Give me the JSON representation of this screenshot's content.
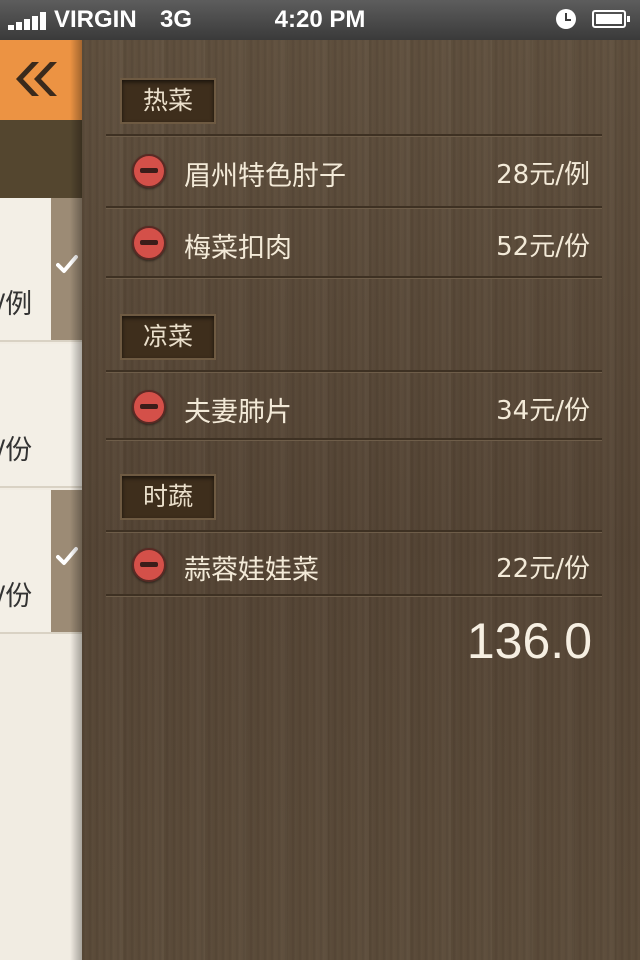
{
  "statusbar": {
    "carrier": "VIRGIN",
    "network": "3G",
    "time": "4:20 PM"
  },
  "sidebar": {
    "items": [
      {
        "price": "/例",
        "checked": true
      },
      {
        "price": "/份",
        "checked": false
      },
      {
        "price": "/份",
        "checked": true
      }
    ]
  },
  "order": {
    "categories": [
      {
        "label": "热菜",
        "dishes": [
          {
            "name": "眉州特色肘子",
            "price": "28元/例"
          },
          {
            "name": "梅菜扣肉",
            "price": "52元/份"
          }
        ]
      },
      {
        "label": "凉菜",
        "dishes": [
          {
            "name": "夫妻肺片",
            "price": "34元/份"
          }
        ]
      },
      {
        "label": "时蔬",
        "dishes": [
          {
            "name": "蒜蓉娃娃菜",
            "price": "22元/份"
          }
        ]
      }
    ],
    "total": "136.0"
  },
  "colors": {
    "accent": "#ec9343",
    "wood": "#5a4a38",
    "remove": "#d45049"
  }
}
